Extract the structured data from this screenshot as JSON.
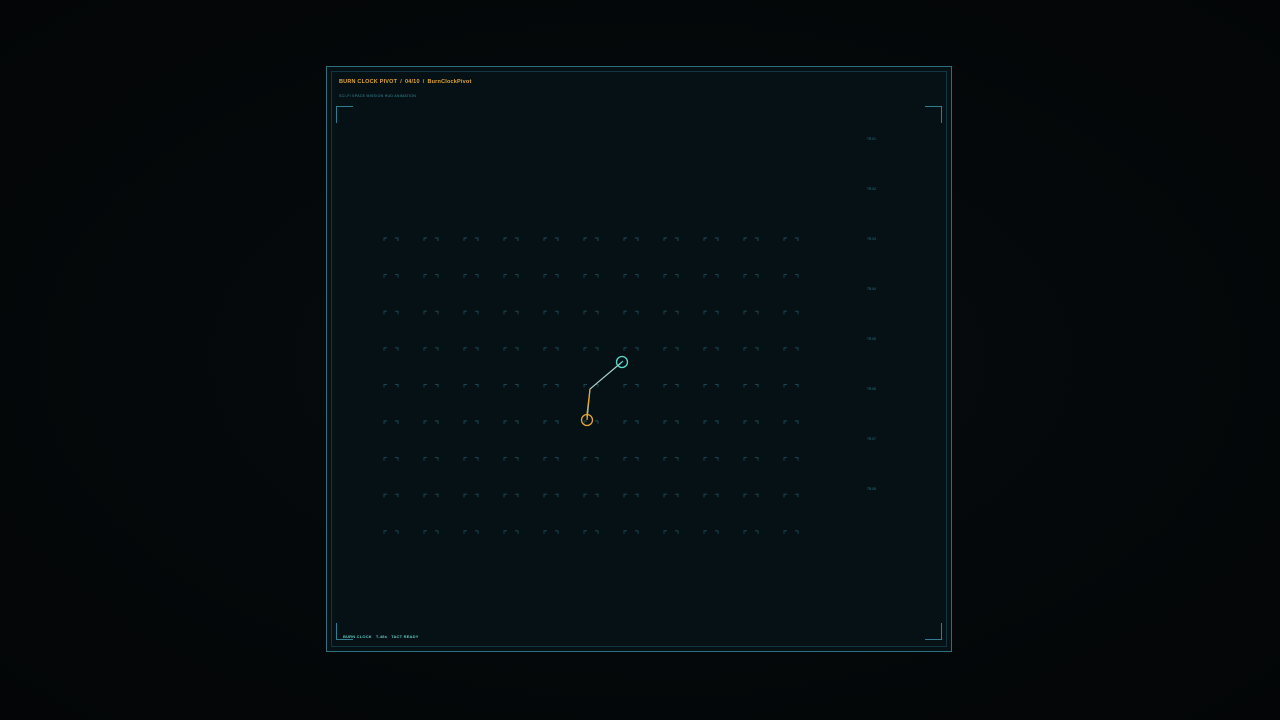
{
  "header": {
    "title_main": "BURN CLOCK PIVOT",
    "title_index": "04/10",
    "title_name": "BurnClockPivot",
    "subtitle": "SCI-FI SPACE MISSION HUD ANIMATION"
  },
  "status": {
    "label": "BURN CLOCK",
    "timer": "T-48s",
    "state": "TACT READY"
  },
  "scale_labels": [
    "TR-01",
    "TR-02",
    "TR-03",
    "TR-04",
    "TR-05",
    "TR-06",
    "TR-07",
    "TR-08"
  ],
  "grid": {
    "columns": 11,
    "rows": 9
  },
  "pivot": {
    "anchor_color": "#e0a534",
    "tip_color": "#5fd8c8"
  },
  "colors": {
    "accent": "#e0a534",
    "cyan": "#5fd8c8",
    "frame": "#2b6f80",
    "marker": "#1f4c57"
  }
}
